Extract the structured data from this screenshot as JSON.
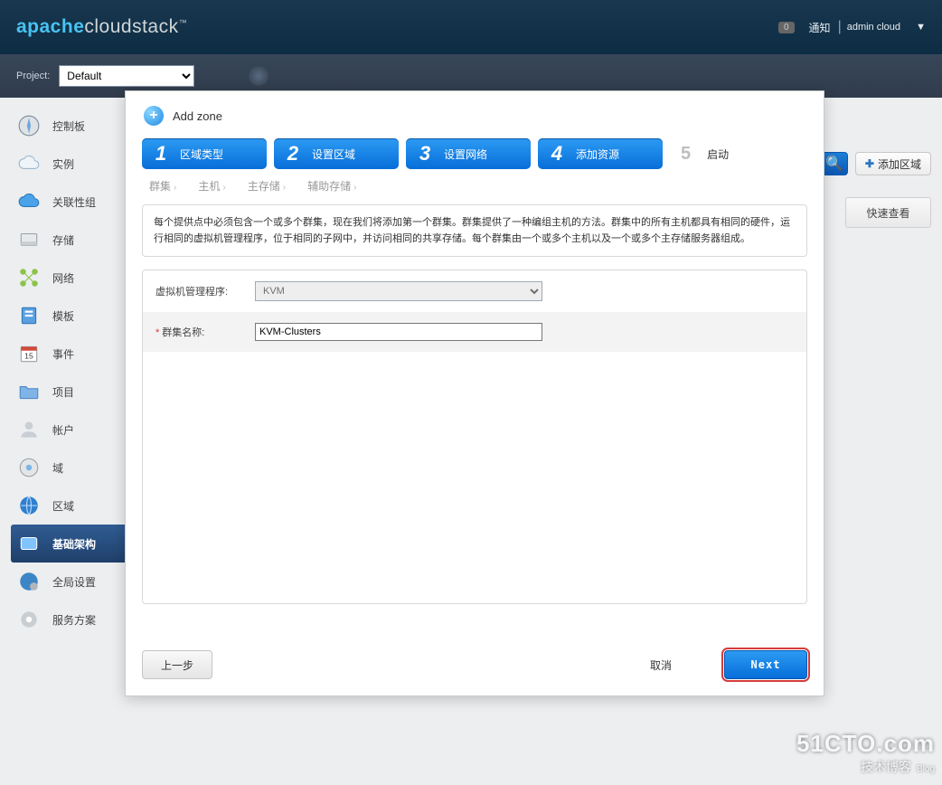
{
  "header": {
    "logo_bold": "apache",
    "logo_light": "cloudstack",
    "notif_count": "0",
    "notif_label": "通知",
    "user": "admin cloud"
  },
  "projectbar": {
    "label": "Project:",
    "value": "Default"
  },
  "sidebar": {
    "items": [
      "控制板",
      "实例",
      "关联性组",
      "存储",
      "网络",
      "模板",
      "事件",
      "项目",
      "帐户",
      "域",
      "区域",
      "基础架构",
      "全局设置",
      "服务方案"
    ],
    "selected_index": 11
  },
  "right": {
    "add_zone": "添加区域",
    "quick_view": "快速查看"
  },
  "modal": {
    "title": "Add zone",
    "steps": [
      {
        "num": "1",
        "label": "区域类型"
      },
      {
        "num": "2",
        "label": "设置区域"
      },
      {
        "num": "3",
        "label": "设置网络"
      },
      {
        "num": "4",
        "label": "添加资源"
      },
      {
        "num": "5",
        "label": "启动"
      }
    ],
    "subtabs": [
      "群集",
      "主机",
      "主存储",
      "辅助存储"
    ],
    "subtab_active": 0,
    "description": "每个提供点中必须包含一个或多个群集，现在我们将添加第一个群集。群集提供了一种编组主机的方法。群集中的所有主机都具有相同的硬件，运行相同的虚拟机管理程序，位于相同的子网中，并访问相同的共享存储。每个群集由一个或多个主机以及一个或多个主存储服务器组成。",
    "form": {
      "hypervisor_label": "虚拟机管理程序:",
      "hypervisor_value": "KVM",
      "cluster_label": "群集名称:",
      "cluster_value": "KVM-Clusters"
    },
    "buttons": {
      "prev": "上一步",
      "cancel": "取消",
      "next": "Next"
    }
  },
  "watermark": {
    "line1": "51CTO.com",
    "line2": "技术博客",
    "line2s": "Blog"
  }
}
